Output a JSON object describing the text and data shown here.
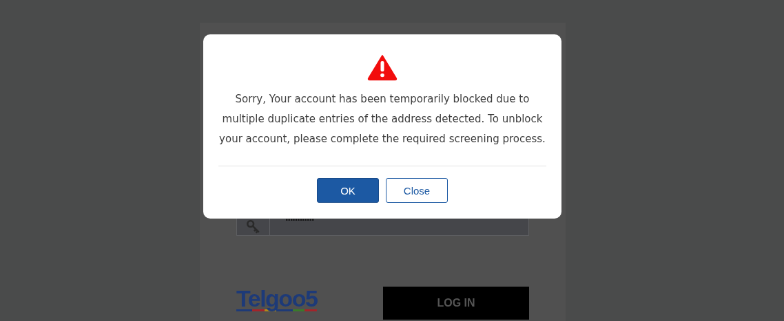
{
  "login": {
    "password_field": {
      "value": "............"
    },
    "logo": "Telgoo5",
    "login_button": "LOG IN"
  },
  "dialog": {
    "message": "Sorry, Your account has been temporarily blocked due to multiple duplicate entries of the address detected. To unblock your account, please complete the required screening process.",
    "buttons": [
      {
        "label": "OK",
        "kind": "primary"
      },
      {
        "label": "Close",
        "kind": "secondary"
      }
    ]
  }
}
